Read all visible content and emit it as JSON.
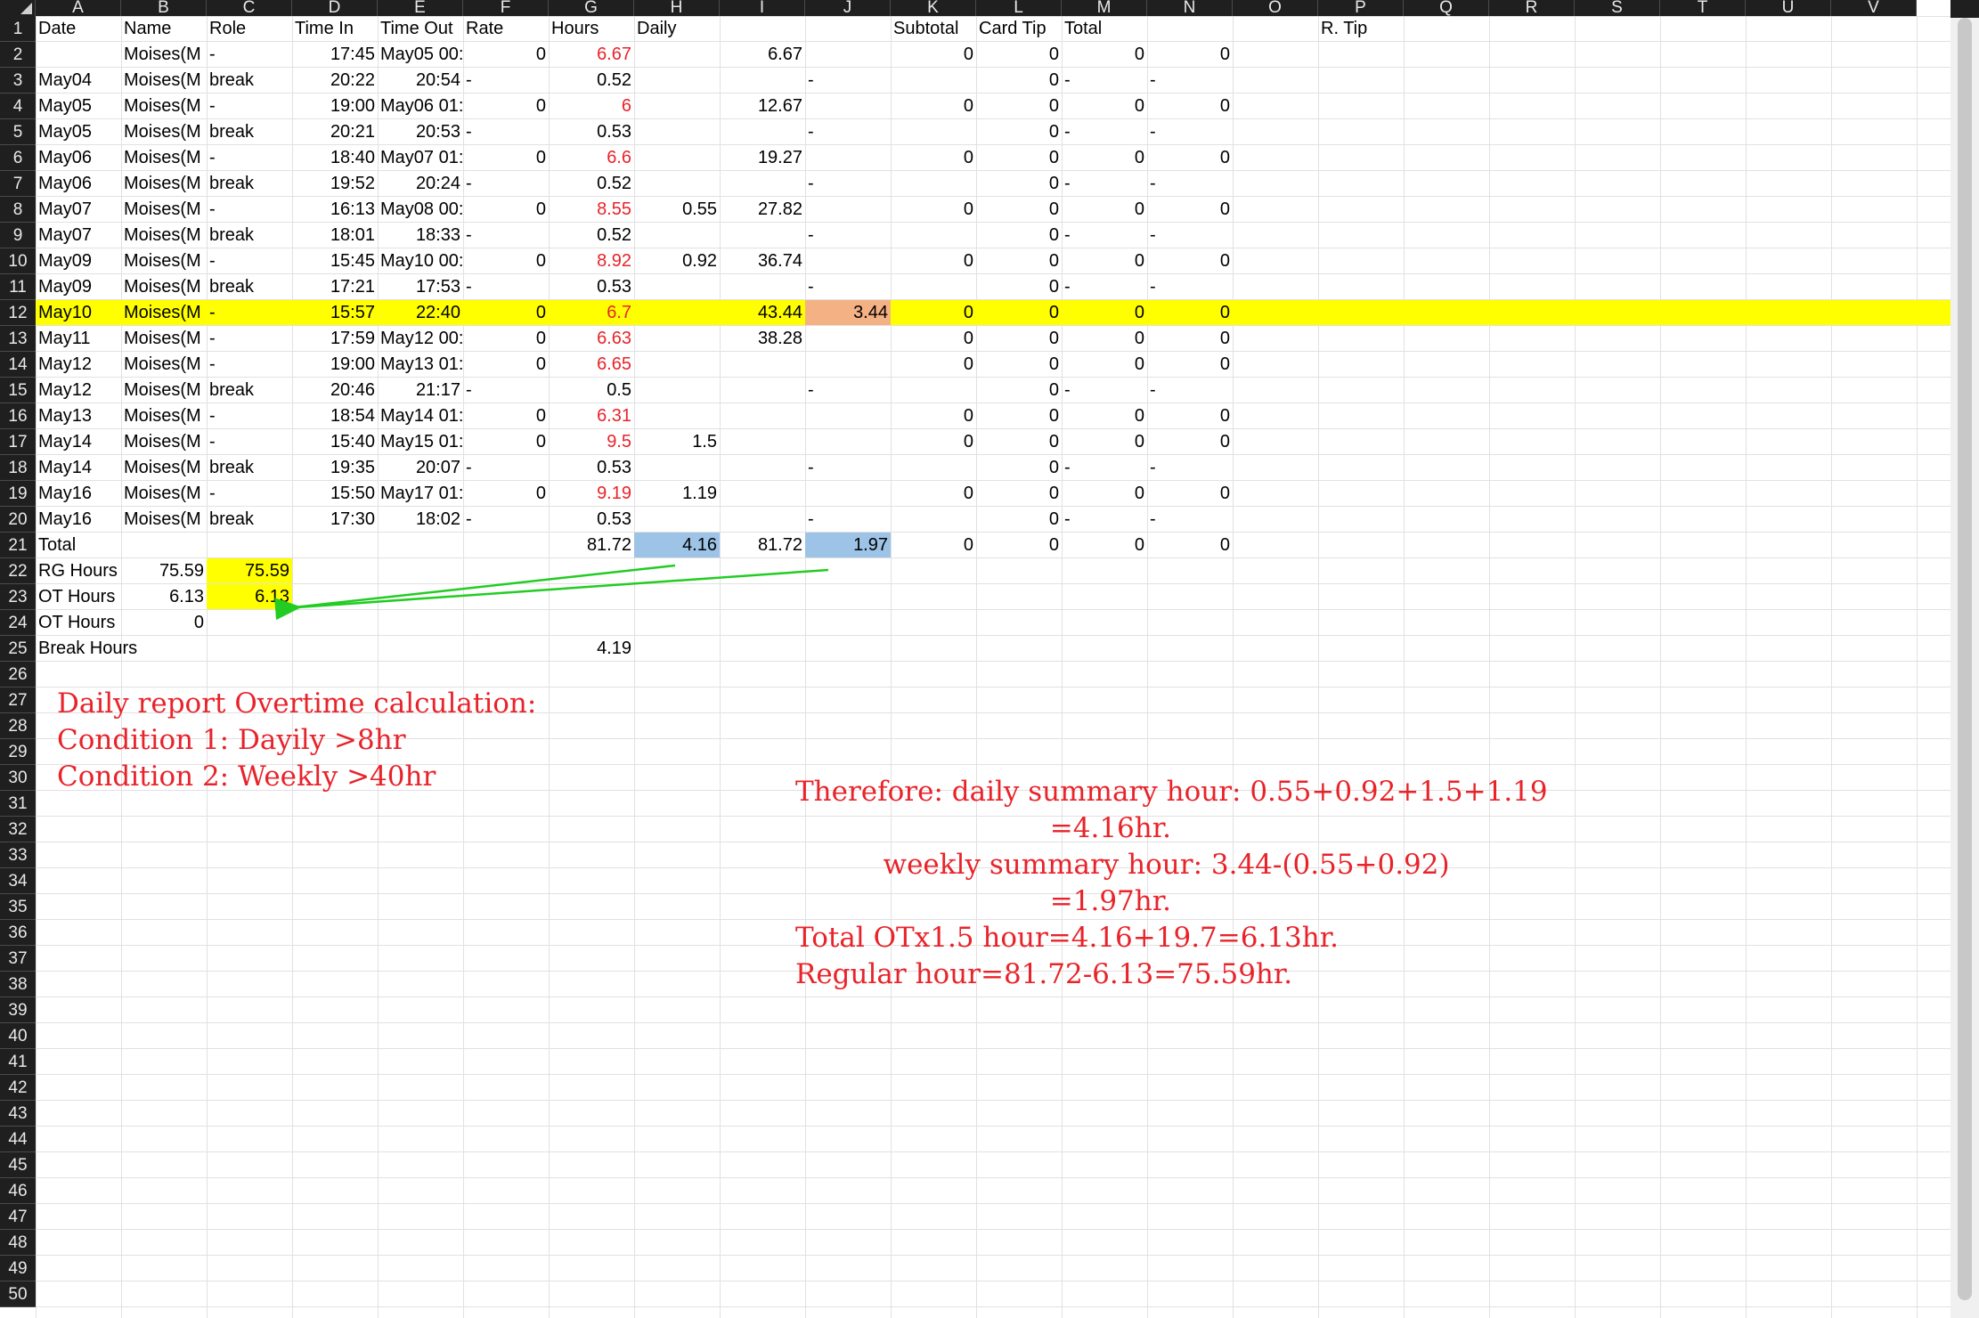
{
  "columns": [
    "A",
    "B",
    "C",
    "D",
    "E",
    "F",
    "G",
    "H",
    "I",
    "J",
    "K",
    "L",
    "M",
    "N",
    "O",
    "P",
    "Q",
    "R",
    "S",
    "T",
    "U",
    "V"
  ],
  "rows": [
    "1",
    "2",
    "3",
    "4",
    "5",
    "6",
    "7",
    "8",
    "9",
    "10",
    "11",
    "12",
    "13",
    "14",
    "15",
    "16",
    "17",
    "18",
    "19",
    "20",
    "21",
    "22",
    "23",
    "24",
    "25",
    "26",
    "27",
    "28",
    "29",
    "30",
    "31",
    "32",
    "33",
    "34",
    "35",
    "36",
    "37",
    "38",
    "39",
    "40",
    "41",
    "42",
    "43",
    "44",
    "45",
    "46",
    "47",
    "48",
    "49",
    "50"
  ],
  "headers": {
    "A": "Date",
    "B": "Name",
    "C": "Role",
    "D": "Time In",
    "E": "Time Out",
    "F": "Rate",
    "G": "Hours",
    "H": "Daily",
    "K": "Subtotal",
    "L": "Card Tip",
    "M": "Total",
    "P": "R. Tip"
  },
  "data_rows": [
    {
      "A": "",
      "B": "Moises(M",
      "C": "-",
      "D": "17:45",
      "E": "May05 00:",
      "F": "0",
      "G": "6.67",
      "H": "",
      "I": "6.67",
      "J": "",
      "K": "0",
      "L": "0",
      "M": "0",
      "N": "0"
    },
    {
      "A": "May04",
      "B": "Moises(M",
      "C": "break",
      "D": "20:22",
      "E": "20:54",
      "F": "-",
      "G": "0.52",
      "H": "",
      "I": "",
      "J": "-",
      "K": "",
      "L": "0",
      "M": "-",
      "N": "-"
    },
    {
      "A": "May05",
      "B": "Moises(M",
      "C": "-",
      "D": "19:00",
      "E": "May06 01:",
      "F": "0",
      "G": "6",
      "H": "",
      "I": "12.67",
      "J": "",
      "K": "0",
      "L": "0",
      "M": "0",
      "N": "0"
    },
    {
      "A": "May05",
      "B": "Moises(M",
      "C": "break",
      "D": "20:21",
      "E": "20:53",
      "F": "-",
      "G": "0.53",
      "H": "",
      "I": "",
      "J": "-",
      "K": "",
      "L": "0",
      "M": "-",
      "N": "-"
    },
    {
      "A": "May06",
      "B": "Moises(M",
      "C": "-",
      "D": "18:40",
      "E": "May07 01:",
      "F": "0",
      "G": "6.6",
      "H": "",
      "I": "19.27",
      "J": "",
      "K": "0",
      "L": "0",
      "M": "0",
      "N": "0"
    },
    {
      "A": "May06",
      "B": "Moises(M",
      "C": "break",
      "D": "19:52",
      "E": "20:24",
      "F": "-",
      "G": "0.52",
      "H": "",
      "I": "",
      "J": "-",
      "K": "",
      "L": "0",
      "M": "-",
      "N": "-"
    },
    {
      "A": "May07",
      "B": "Moises(M",
      "C": "-",
      "D": "16:13",
      "E": "May08 00:",
      "F": "0",
      "G": "8.55",
      "H": "0.55",
      "I": "27.82",
      "J": "",
      "K": "0",
      "L": "0",
      "M": "0",
      "N": "0"
    },
    {
      "A": "May07",
      "B": "Moises(M",
      "C": "break",
      "D": "18:01",
      "E": "18:33",
      "F": "-",
      "G": "0.52",
      "H": "",
      "I": "",
      "J": "-",
      "K": "",
      "L": "0",
      "M": "-",
      "N": "-"
    },
    {
      "A": "May09",
      "B": "Moises(M",
      "C": "-",
      "D": "15:45",
      "E": "May10 00:",
      "F": "0",
      "G": "8.92",
      "H": "0.92",
      "I": "36.74",
      "J": "",
      "K": "0",
      "L": "0",
      "M": "0",
      "N": "0"
    },
    {
      "A": "May09",
      "B": "Moises(M",
      "C": "break",
      "D": "17:21",
      "E": "17:53",
      "F": "-",
      "G": "0.53",
      "H": "",
      "I": "",
      "J": "-",
      "K": "",
      "L": "0",
      "M": "-",
      "N": "-"
    },
    {
      "A": "May10",
      "B": "Moises(M",
      "C": "-",
      "D": "15:57",
      "E": "22:40",
      "F": "0",
      "G": "6.7",
      "H": "",
      "I": "43.44",
      "J": "3.44",
      "K": "0",
      "L": "0",
      "M": "0",
      "N": "0"
    },
    {
      "A": "May11",
      "B": "Moises(M",
      "C": "-",
      "D": "17:59",
      "E": "May12 00:",
      "F": "0",
      "G": "6.63",
      "H": "",
      "I": "38.28",
      "J": "",
      "K": "0",
      "L": "0",
      "M": "0",
      "N": "0"
    },
    {
      "A": "May12",
      "B": "Moises(M",
      "C": "-",
      "D": "19:00",
      "E": "May13 01:",
      "F": "0",
      "G": "6.65",
      "H": "",
      "I": "",
      "J": "",
      "K": "0",
      "L": "0",
      "M": "0",
      "N": "0"
    },
    {
      "A": "May12",
      "B": "Moises(M",
      "C": "break",
      "D": "20:46",
      "E": "21:17",
      "F": "-",
      "G": "0.5",
      "H": "",
      "I": "",
      "J": "-",
      "K": "",
      "L": "0",
      "M": "-",
      "N": "-"
    },
    {
      "A": "May13",
      "B": "Moises(M",
      "C": "-",
      "D": "18:54",
      "E": "May14 01:",
      "F": "0",
      "G": "6.31",
      "H": "",
      "I": "",
      "J": "",
      "K": "0",
      "L": "0",
      "M": "0",
      "N": "0"
    },
    {
      "A": "May14",
      "B": "Moises(M",
      "C": "-",
      "D": "15:40",
      "E": "May15 01:",
      "F": "0",
      "G": "9.5",
      "H": "1.5",
      "I": "",
      "J": "",
      "K": "0",
      "L": "0",
      "M": "0",
      "N": "0"
    },
    {
      "A": "May14",
      "B": "Moises(M",
      "C": "break",
      "D": "19:35",
      "E": "20:07",
      "F": "-",
      "G": "0.53",
      "H": "",
      "I": "",
      "J": "-",
      "K": "",
      "L": "0",
      "M": "-",
      "N": "-"
    },
    {
      "A": "May16",
      "B": "Moises(M",
      "C": "-",
      "D": "15:50",
      "E": "May17 01:",
      "F": "0",
      "G": "9.19",
      "H": "1.19",
      "I": "",
      "J": "",
      "K": "0",
      "L": "0",
      "M": "0",
      "N": "0"
    },
    {
      "A": "May16",
      "B": "Moises(M",
      "C": "break",
      "D": "17:30",
      "E": "18:02",
      "F": "-",
      "G": "0.53",
      "H": "",
      "I": "",
      "J": "-",
      "K": "",
      "L": "0",
      "M": "-",
      "N": "-"
    },
    {
      "A": "Total",
      "B": "",
      "C": "",
      "D": "",
      "E": "",
      "F": "",
      "G": "81.72",
      "H": "4.16",
      "I": "81.72",
      "J": "1.97",
      "K": "0",
      "L": "0",
      "M": "0",
      "N": "0"
    }
  ],
  "summary_rows": [
    {
      "A": "RG Hours",
      "B": "75.59",
      "C": "75.59"
    },
    {
      "A": "OT Hours",
      "B": "6.13",
      "C": "6.13"
    },
    {
      "A": "OT Hours",
      "B": "0",
      "C": ""
    },
    {
      "A": "Break Hours",
      "B": "",
      "C": "",
      "G": "4.19"
    }
  ],
  "red_hours_rows": [
    2,
    4,
    6,
    8,
    10,
    12,
    13,
    14,
    16,
    17,
    19
  ],
  "notes": {
    "left": "Daily report Overtime calculation:\nCondition 1: Dayily >8hr\nCondition 2: Weekly >40hr",
    "right": "Therefore: daily summary hour: 0.55+0.92+1.5+1.19\n                             =4.16hr.\n          weekly summary hour: 3.44-(0.55+0.92)\n                             =1.97hr.\nTotal OTx1.5 hour=4.16+19.7=6.13hr.\nRegular hour=81.72-6.13=75.59hr."
  },
  "colors": {
    "highlight_row": "#ffff00",
    "orange_cell": "#f4b183",
    "blue_cell": "#9dc3e6",
    "yellow_cell": "#ffff00",
    "arrow": "#22cc22",
    "note_text": "#e8232a",
    "header_bg": "#1f1f1f"
  }
}
